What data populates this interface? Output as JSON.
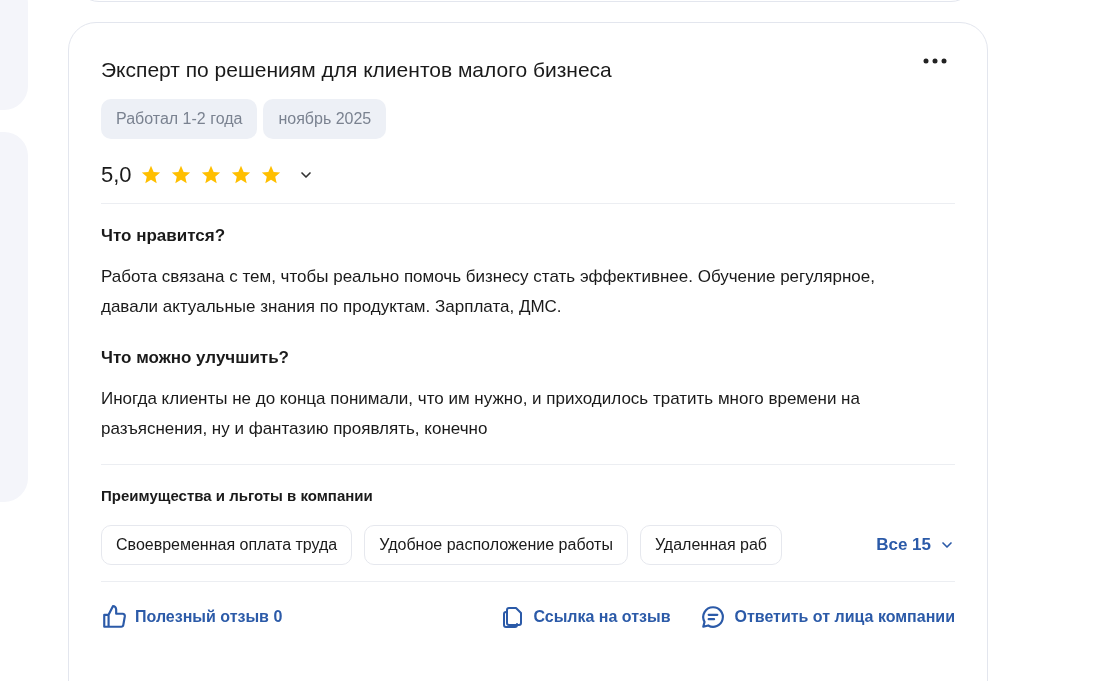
{
  "review": {
    "title": "Эксперт по решениям для клиентов малого бизнеса",
    "tags": [
      "Работал 1-2 года",
      "ноябрь 2025"
    ],
    "rating": {
      "value": "5,0",
      "stars": 5
    },
    "sections": [
      {
        "heading": "Что нравится?",
        "text": "Работа связана с тем, чтобы реально помочь бизнесу стать эффективнее. Обучение регулярное, давали актуальные знания по продуктам. Зарплата, ДМС."
      },
      {
        "heading": "Что можно улучшить?",
        "text": "Иногда клиенты не до конца понимали, что им нужно, и приходилось тратить много времени на разъяснения, ну и фантазию проявлять, конечно"
      }
    ],
    "benefits": {
      "heading": "Преимущества и льготы в компании",
      "items": [
        "Своевременная оплата труда",
        "Удобное расположение работы",
        "Удаленная раб"
      ],
      "more": "Все 15"
    },
    "actions": [
      {
        "kind": "like",
        "label": "Полезный отзыв 0"
      },
      {
        "kind": "link",
        "label": "Ссылка на отзыв"
      },
      {
        "kind": "reply",
        "label": "Ответить от лица компании"
      }
    ]
  }
}
